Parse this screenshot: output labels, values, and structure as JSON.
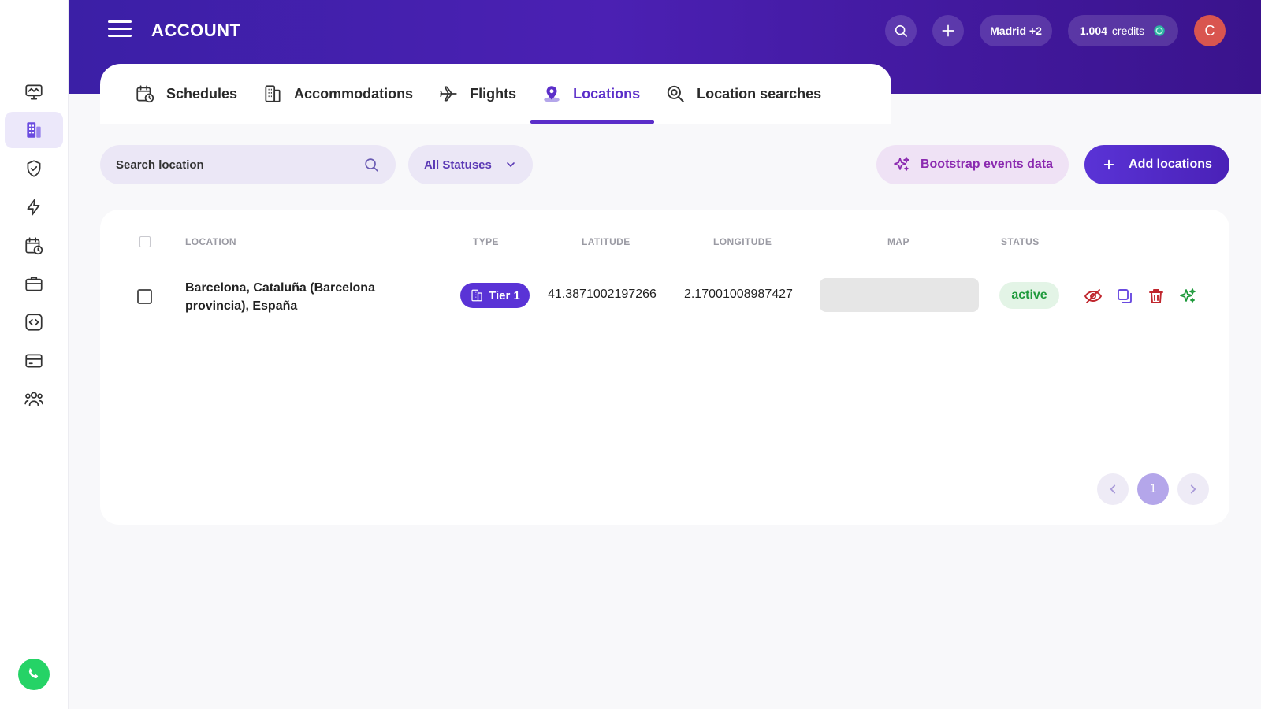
{
  "header": {
    "title": "ACCOUNT",
    "location_chip": "Madrid +2",
    "credits_amount": "1.004",
    "credits_label": "credits",
    "avatar_initial": "C"
  },
  "sidebar": {
    "items": [
      {
        "icon": "monitor-icon"
      },
      {
        "icon": "building-icon",
        "active": true
      },
      {
        "icon": "shield-check-icon"
      },
      {
        "icon": "bolt-icon"
      },
      {
        "icon": "calendar-clock-icon"
      },
      {
        "icon": "briefcase-icon"
      },
      {
        "icon": "code-icon"
      },
      {
        "icon": "credit-card-icon"
      },
      {
        "icon": "users-icon"
      }
    ]
  },
  "tabs": [
    {
      "label": "Schedules",
      "icon": "calendar-clock-icon"
    },
    {
      "label": "Accommodations",
      "icon": "building-icon"
    },
    {
      "label": "Flights",
      "icon": "plane-icon"
    },
    {
      "label": "Locations",
      "icon": "location-pin-icon",
      "active": true
    },
    {
      "label": "Location searches",
      "icon": "search-location-icon"
    }
  ],
  "toolbar": {
    "search_placeholder": "Search location",
    "status_filter": "All Statuses",
    "bootstrap_label": "Bootstrap events data",
    "add_label": "Add locations"
  },
  "table": {
    "columns": [
      "LOCATION",
      "TYPE",
      "LATITUDE",
      "LONGITUDE",
      "MAP",
      "STATUS"
    ],
    "rows": [
      {
        "location": "Barcelona, Cataluña (Barcelona provincia), España",
        "type": "Tier 1",
        "latitude": "41.3871002197266",
        "longitude": "2.17001008987427",
        "status": "active"
      }
    ]
  },
  "pagination": {
    "current": "1"
  },
  "colors": {
    "primary": "#5a33d6",
    "header_start": "#3b1fa6",
    "active_green": "#1f9a3c",
    "delete_red": "#c0262d",
    "bootstrap_purple": "#8b2ab0"
  }
}
